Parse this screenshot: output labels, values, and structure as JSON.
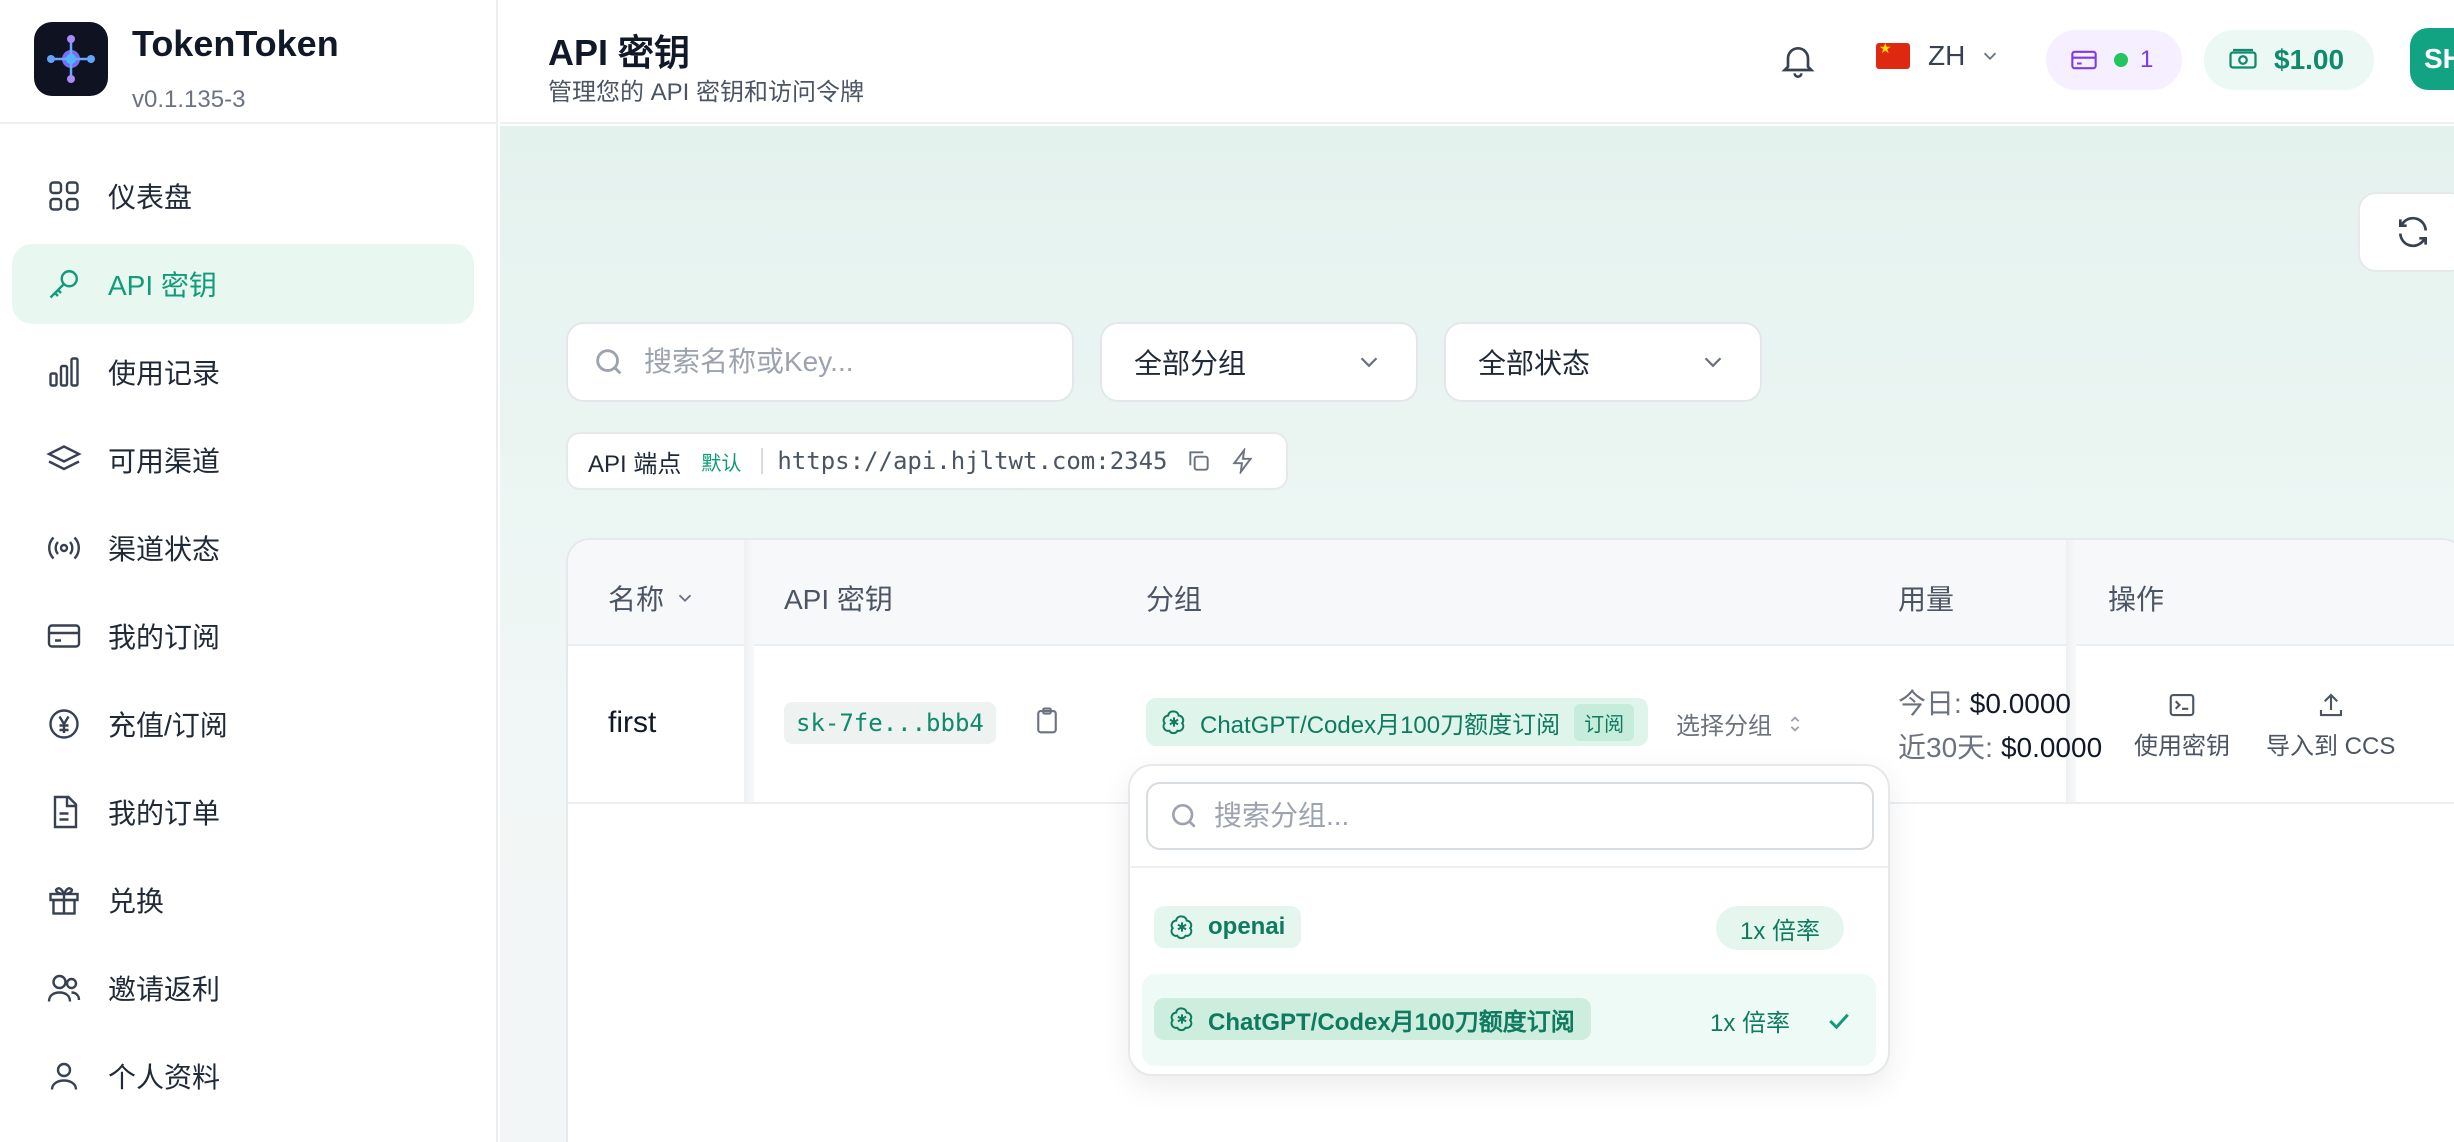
{
  "brand": {
    "name": "TokenToken",
    "version": "v0.1.135-3"
  },
  "sidebar": {
    "items": [
      {
        "label": "仪表盘",
        "icon": "dashboard-icon"
      },
      {
        "label": "API 密钥",
        "icon": "key-icon",
        "active": true
      },
      {
        "label": "使用记录",
        "icon": "bar-chart-icon"
      },
      {
        "label": "可用渠道",
        "icon": "layers-icon"
      },
      {
        "label": "渠道状态",
        "icon": "signal-icon"
      },
      {
        "label": "我的订阅",
        "icon": "card-icon"
      },
      {
        "label": "充值/订阅",
        "icon": "yen-icon"
      },
      {
        "label": "我的订单",
        "icon": "document-icon"
      },
      {
        "label": "兑换",
        "icon": "gift-icon"
      },
      {
        "label": "邀请返利",
        "icon": "users-icon"
      },
      {
        "label": "个人资料",
        "icon": "user-icon"
      }
    ]
  },
  "header": {
    "title": "API 密钥",
    "subtitle": "管理您的 API 密钥和访问令牌",
    "language": "ZH",
    "subscription_count": "1",
    "balance": "$1.00",
    "avatar_text": "SH"
  },
  "filters": {
    "search_placeholder": "搜索名称或Key...",
    "group_select": "全部分组",
    "status_select": "全部状态"
  },
  "endpoint": {
    "label": "API 端点",
    "default_tag": "默认",
    "url": "https://api.hjltwt.com:2345"
  },
  "table": {
    "headers": {
      "name": "名称",
      "key": "API 密钥",
      "group": "分组",
      "usage": "用量",
      "actions": "操作"
    },
    "rows": [
      {
        "name": "first",
        "key": "sk-7fe...bbb4",
        "group": "ChatGPT/Codex月100刀额度订阅",
        "group_tag": "订阅",
        "select_group": "选择分组",
        "today_label": "今日:",
        "today_value": "$0.0000",
        "month_label": "近30天:",
        "month_value": "$0.0000",
        "action_use": "使用密钥",
        "action_import": "导入到 CCS"
      }
    ]
  },
  "group_dropdown": {
    "search_placeholder": "搜索分组...",
    "options": [
      {
        "name": "openai",
        "rate": "1x 倍率",
        "selected": false
      },
      {
        "name": "ChatGPT/Codex月100刀额度订阅",
        "rate": "1x 倍率",
        "selected": true
      }
    ]
  },
  "colors": {
    "accent": "#109b7b",
    "active_bg": "#e9f7f1",
    "subscription": "#7c3aed"
  }
}
